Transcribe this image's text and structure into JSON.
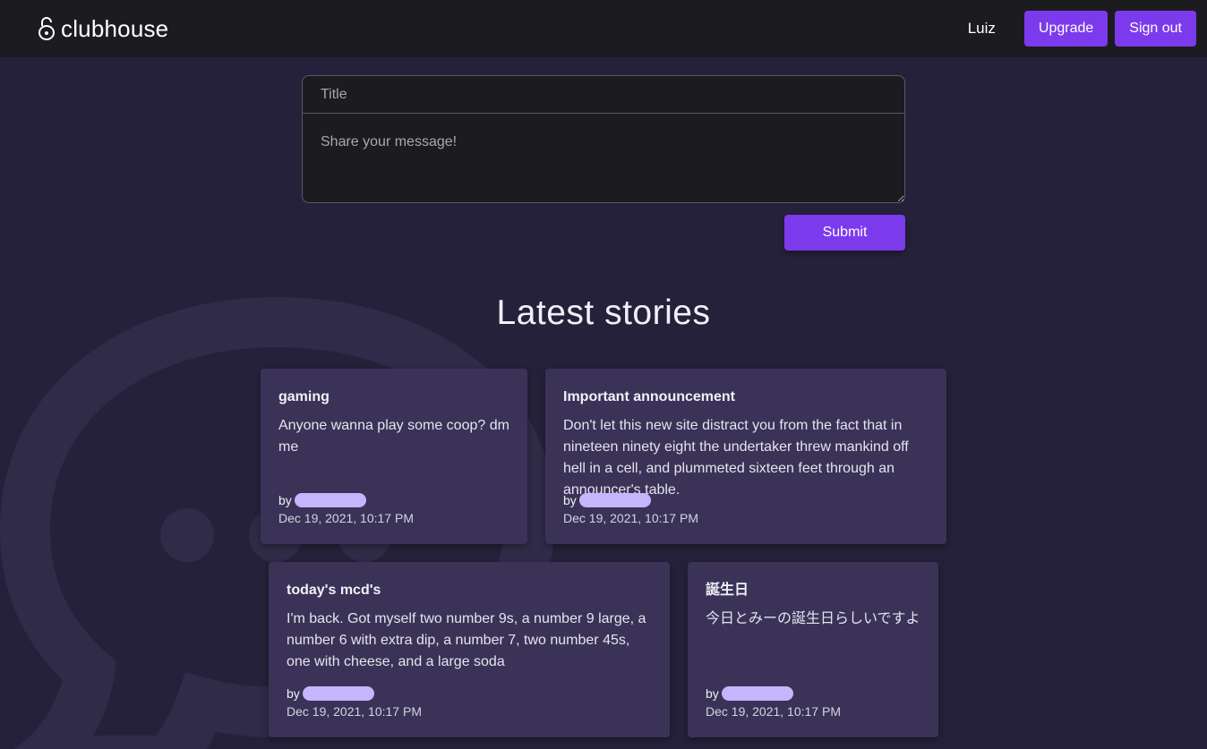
{
  "header": {
    "logo_text": "clubhouse",
    "logo_icon": "unlock-icon",
    "user_name": "Luiz",
    "upgrade_label": "Upgrade",
    "signout_label": "Sign out"
  },
  "composer": {
    "title_placeholder": "Title",
    "message_placeholder": "Share your message!",
    "submit_label": "Submit"
  },
  "stories_heading": "Latest stories",
  "stories": [
    {
      "title": "gaming",
      "body": "Anyone wanna play some coop? dm me",
      "by": "by",
      "date": "Dec 19, 2021, 10:17 PM"
    },
    {
      "title": "Important announcement",
      "body": "Don't let this new site distract you from the fact that in nineteen ninety eight the undertaker threw mankind off hell in a cell, and plummeted sixteen feet through an announcer's table.",
      "by": "by",
      "date": "Dec 19, 2021, 10:17 PM"
    },
    {
      "title": "today's mcd's",
      "body": "I'm back. Got myself two number 9s, a number 9 large, a number 6 with extra dip, a number 7, two number 45s, one with cheese, and a large soda",
      "by": "by",
      "date": "Dec 19, 2021, 10:17 PM"
    },
    {
      "title": "誕生日",
      "body": "今日とみーの誕生日らしいですよ",
      "by": "by",
      "date": "Dec 19, 2021, 10:17 PM"
    }
  ],
  "colors": {
    "accent": "#7c3aed",
    "page_background": "#25213a",
    "topbar_background": "#1c1b1f",
    "card_background": "#3a3357",
    "author_pill": "#c4b5fd"
  }
}
